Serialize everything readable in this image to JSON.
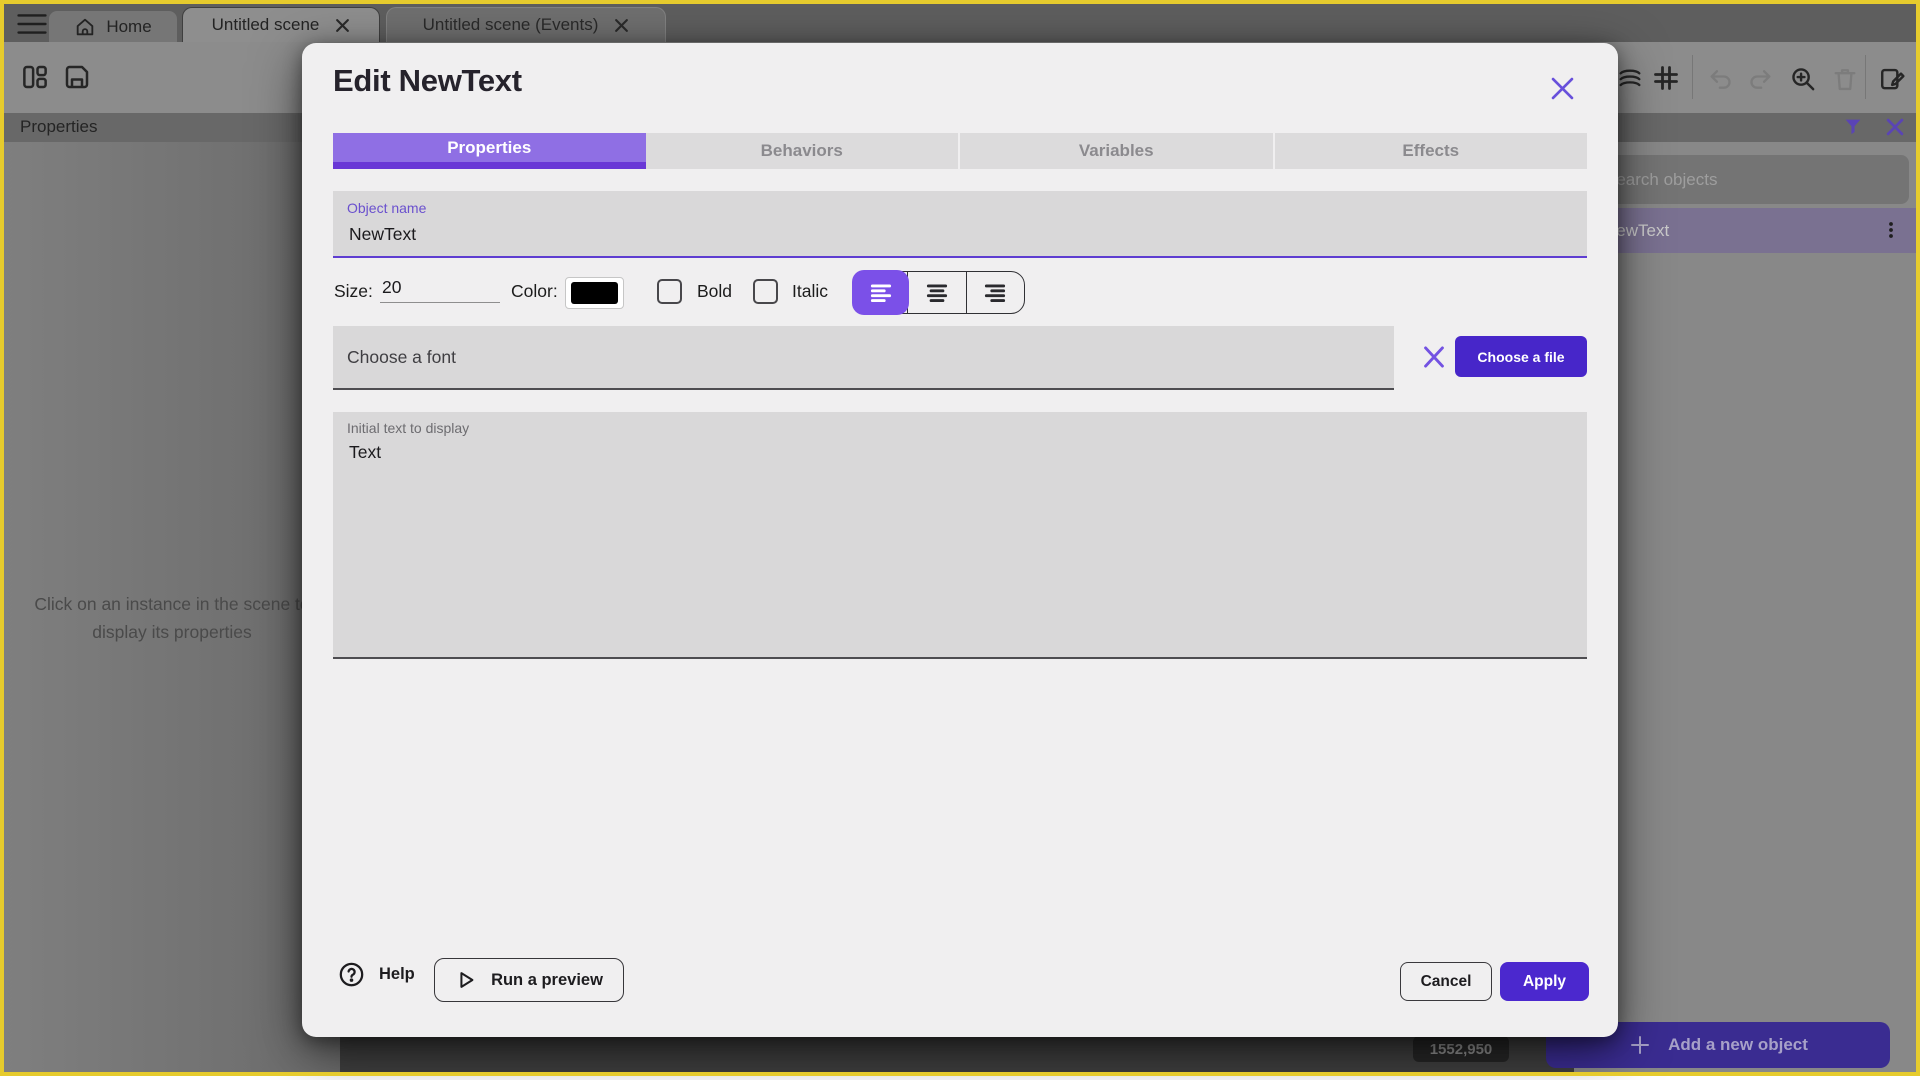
{
  "app": {
    "tabbar": {
      "home_tab": {
        "label": "Home"
      },
      "scene_tab": {
        "label": "Untitled scene"
      },
      "events_tab": {
        "label": "Untitled scene (Events)"
      }
    },
    "toolbar_icons_left": [
      "panels-icon",
      "save-icon"
    ],
    "toolbar_icons_right": [
      "layers-icon",
      "grid-icon",
      "undo-icon",
      "redo-icon",
      "zoom-in-icon",
      "trash-icon",
      "edit-scene-icon"
    ],
    "left_panel": {
      "header": "Properties",
      "empty_message_line1": "Click on an instance in the scene to",
      "empty_message_line2": "display its properties"
    },
    "right_panel": {
      "header_icons": [
        "filter-icon",
        "close-icon"
      ],
      "search_placeholder": "Search objects",
      "object_item": "NewText",
      "coords_badge": "1552,950",
      "add_button": "Add a new object"
    }
  },
  "modal": {
    "title": "Edit NewText",
    "tabs": [
      {
        "label": "Properties",
        "active": true
      },
      {
        "label": "Behaviors",
        "active": false
      },
      {
        "label": "Variables",
        "active": false
      },
      {
        "label": "Effects",
        "active": false
      }
    ],
    "object_name": {
      "label": "Object name",
      "value": "NewText"
    },
    "size_label": "Size:",
    "size_value": "20",
    "color_label": "Color:",
    "color_value": "#000000",
    "bold_label": "Bold",
    "bold_checked": false,
    "italic_label": "Italic",
    "italic_checked": false,
    "alignment_selected": "left",
    "font_placeholder": "Choose a font",
    "choose_file_button": "Choose a file",
    "initial_text": {
      "label": "Initial text to display",
      "value": "Text"
    },
    "footer": {
      "help": "Help",
      "run_preview": "Run a preview",
      "cancel": "Cancel",
      "apply": "Apply"
    }
  },
  "colors": {
    "focus_border_yellow": "#E6CB2D",
    "accent_purple": "#6850DB",
    "active_tab_purple": "#8F6FE4",
    "tab_underline_purple": "#6937D6",
    "button_purple": "#4726C9",
    "field_gray": "#D9D8D9",
    "modal_bg": "#F0EFF0"
  }
}
